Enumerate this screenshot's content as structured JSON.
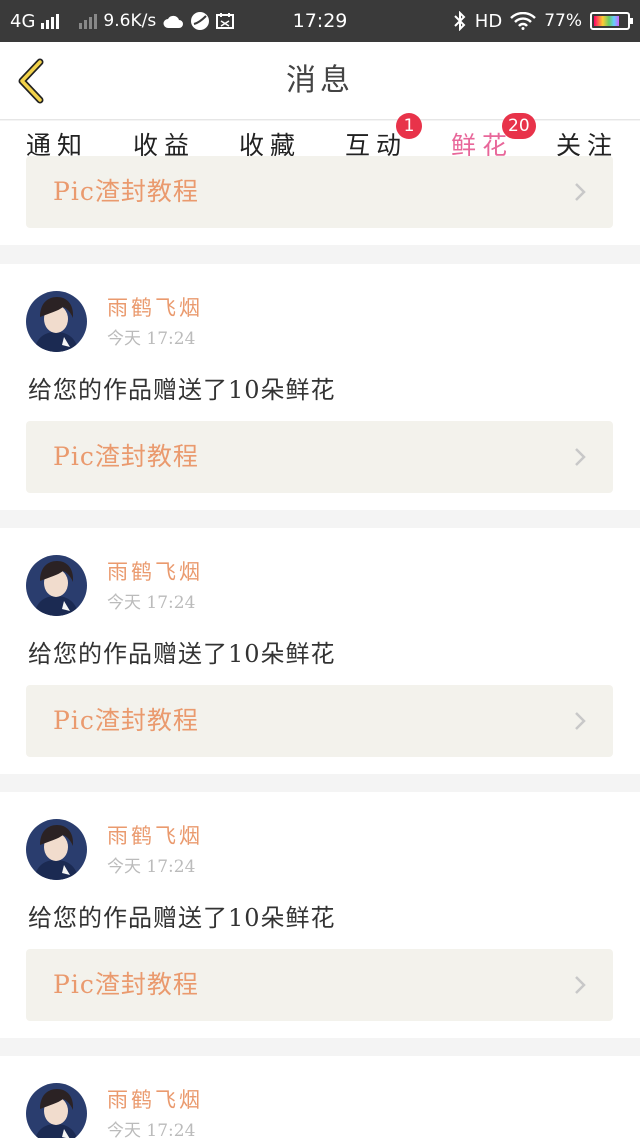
{
  "status_bar": {
    "network": "4G",
    "speed": "9.6K/s",
    "time": "17:29",
    "hd": "HD",
    "battery": "77%",
    "battery_level": 0.77
  },
  "header": {
    "title": "消息",
    "back_icon": "chevron-left-icon"
  },
  "tabs": [
    {
      "label": "通知",
      "badge": ""
    },
    {
      "label": "收益",
      "badge": ""
    },
    {
      "label": "收藏",
      "badge": ""
    },
    {
      "label": "互动",
      "badge": "1"
    },
    {
      "label": "鲜花",
      "badge": "20",
      "active": true
    },
    {
      "label": "关注",
      "badge": ""
    }
  ],
  "partial_card": {
    "link": "Pic渣封教程"
  },
  "messages": [
    {
      "user": "雨鹤飞烟",
      "time": "今天 17:24",
      "text": "给您的作品赠送了10朵鲜花",
      "link": "Pic渣封教程"
    },
    {
      "user": "雨鹤飞烟",
      "time": "今天 17:24",
      "text": "给您的作品赠送了10朵鲜花",
      "link": "Pic渣封教程"
    },
    {
      "user": "雨鹤飞烟",
      "time": "今天 17:24",
      "text": "给您的作品赠送了10朵鲜花",
      "link": "Pic渣封教程"
    },
    {
      "user": "雨鹤飞烟",
      "time": "今天 17:24"
    }
  ],
  "colors": {
    "accent": "#e8679a",
    "link": "#ea9a6e",
    "badge": "#e8334a"
  }
}
